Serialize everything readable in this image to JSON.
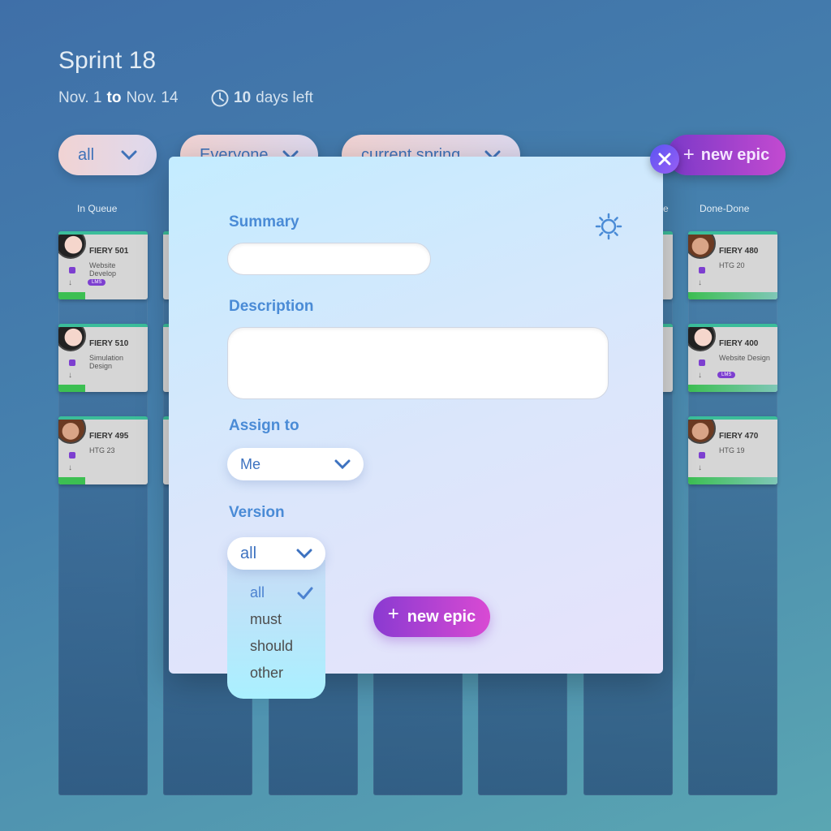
{
  "header": {
    "title": "Sprint 18",
    "date_from": "Nov. 1",
    "date_to_word": "to",
    "date_to": "Nov. 14",
    "days_left_num": "10",
    "days_left_text": "days left"
  },
  "filters": {
    "type": "all",
    "people": "Everyone",
    "sprint": "current spring"
  },
  "new_epic_label": "new epic",
  "columns": {
    "in_queue": "In Queue",
    "done_partial": "e",
    "done_done": "Done-Done"
  },
  "cards": {
    "left": [
      {
        "title": "FIERY 501",
        "sub": "Website Develop",
        "tag": "LMS"
      },
      {
        "title": "FIERY 510",
        "sub": "Simulation Design",
        "tag": ""
      },
      {
        "title": "FIERY 495",
        "sub": "HTG 23",
        "tag": ""
      }
    ],
    "right": [
      {
        "title": "FIERY 480",
        "sub": "HTG 20",
        "tag": ""
      },
      {
        "title": "FIERY 400",
        "sub": "Website Design",
        "tag": "LMS"
      },
      {
        "title": "FIERY 470",
        "sub": "HTG 19",
        "tag": ""
      }
    ]
  },
  "modal": {
    "summary_label": "Summary",
    "summary_value": "",
    "description_label": "Description",
    "description_value": "",
    "assign_label": "Assign to",
    "assign_value": "Me",
    "version_label": "Version",
    "version_value": "all",
    "version_options": [
      "all",
      "must",
      "should",
      "other"
    ],
    "submit_label": "new epic"
  },
  "colors": {
    "accent": "#4a8bd6",
    "epic_gradient_start": "#8a3ad1",
    "epic_gradient_end": "#d94ad3",
    "progress_green": "#3cbf52"
  }
}
